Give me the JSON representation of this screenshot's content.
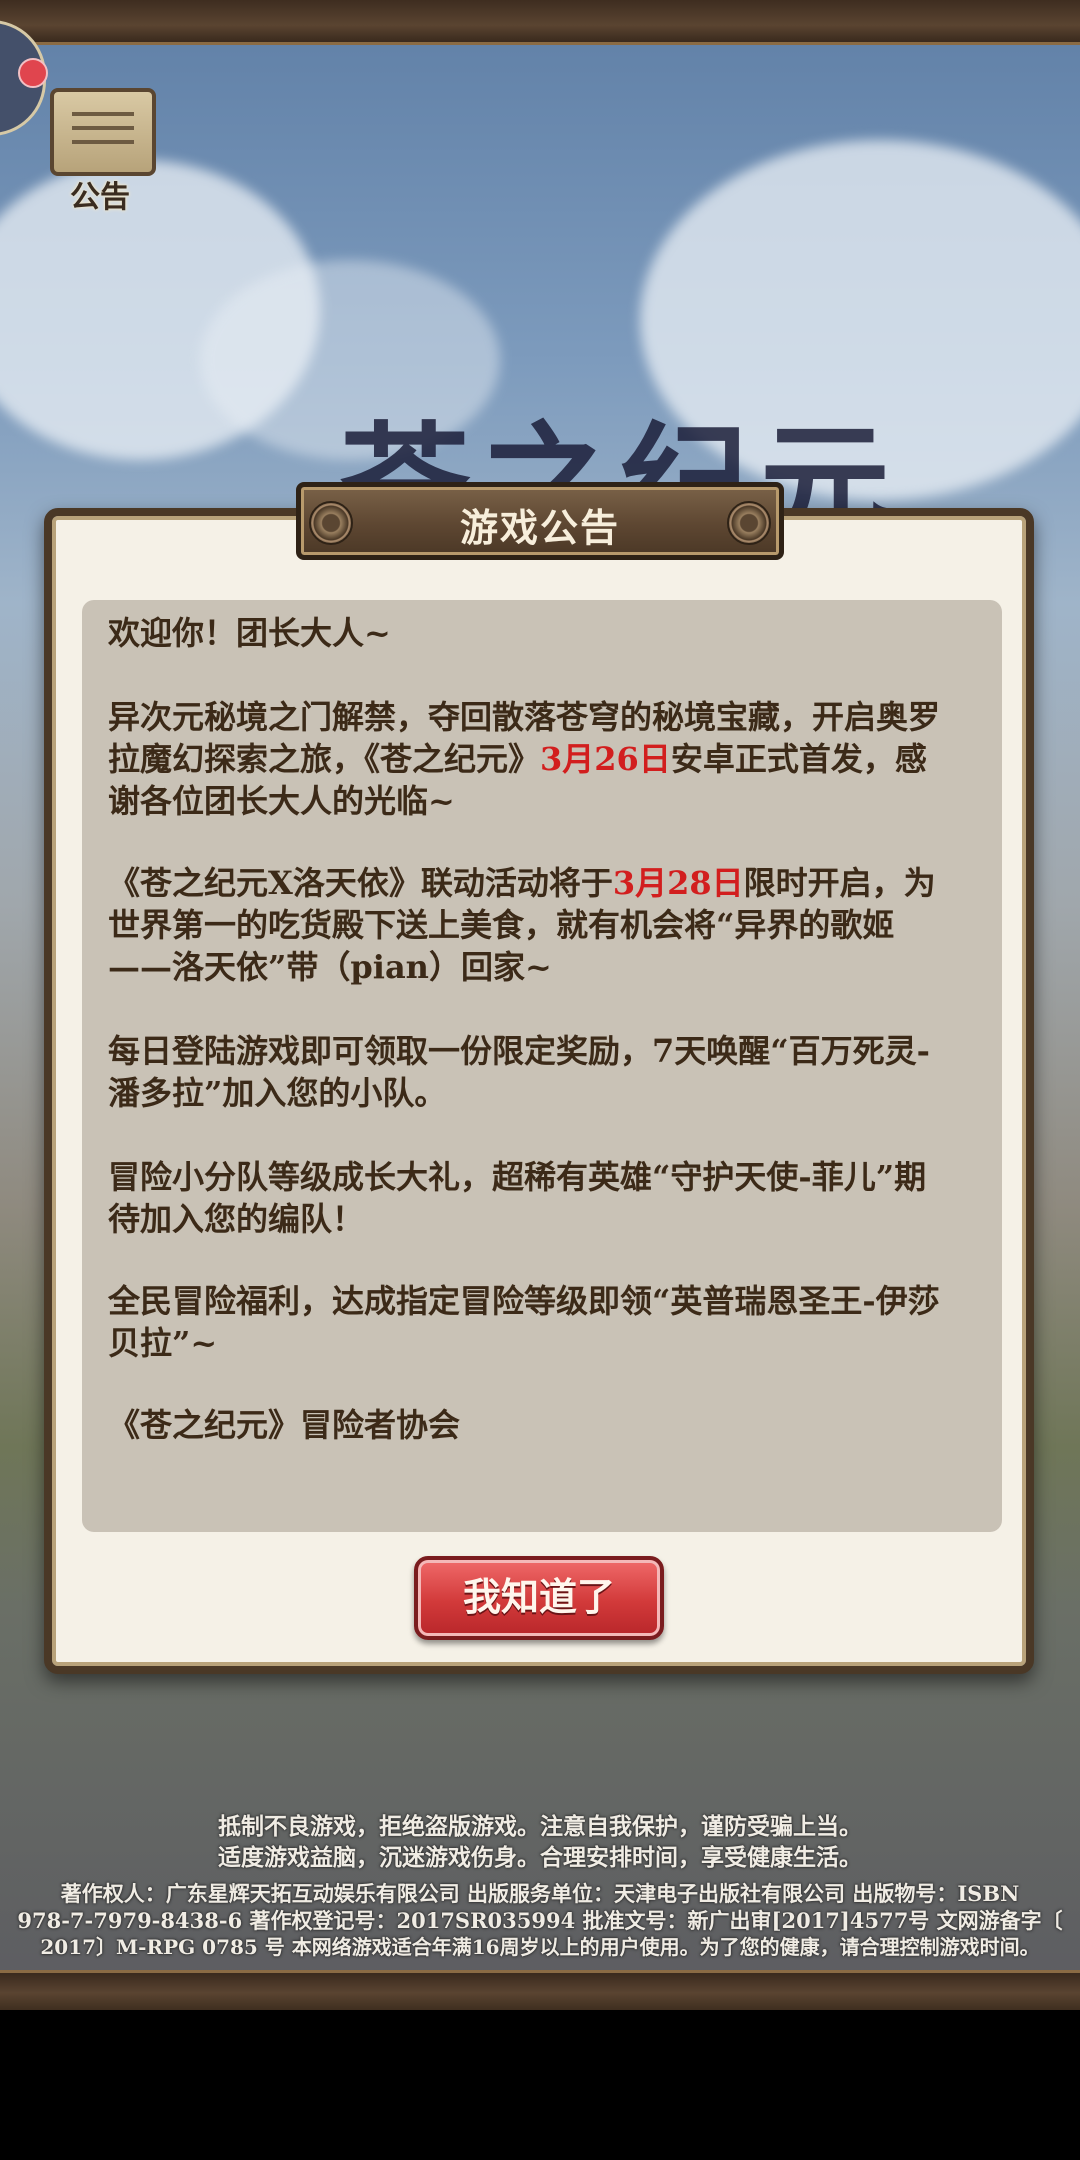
{
  "hud": {
    "notice_label": "公告"
  },
  "background": {
    "title_fragment": "苍之纪元"
  },
  "dialog": {
    "title": "游戏公告",
    "p1": "欢迎你！团长大人~",
    "p2_a": "异次元秘境之门解禁，夺回散落苍穹的秘境宝藏，开启奥罗拉魔幻探索之旅，《苍之纪元》",
    "p2_hl": "3月26日",
    "p2_b": "安卓正式首发，感谢各位团长大人的光临~",
    "p3_a": "《苍之纪元X洛天依》联动活动将于",
    "p3_hl": "3月28日",
    "p3_b": "限时开启，为世界第一的吃货殿下送上美食，就有机会将“异界的歌姬——洛天依”带（pian）回家~",
    "p4": "每日登陆游戏即可领取一份限定奖励，7天唤醒“百万死灵-潘多拉”加入您的小队。",
    "p5": "冒险小分队等级成长大礼，超稀有英雄“守护天使-菲儿”期待加入您的编队！",
    "p6": "全民冒险福利，达成指定冒险等级即领“英普瑞恩圣王-伊莎贝拉”~",
    "p7": "《苍之纪元》冒险者协会",
    "ok_button": "我知道了",
    "highlight_color": "#d21e1e"
  },
  "footer": {
    "line1": "抵制不良游戏，拒绝盗版游戏。注意自我保护，谨防受骗上当。",
    "line2": "适度游戏益脑，沉迷游戏伤身。合理安排时间，享受健康生活。",
    "line3": "著作权人：广东星辉天拓互动娱乐有限公司  出版服务单位：天津电子出版社有限公司  出版物号：ISBN",
    "line4": "978-7-7979-8438-6  著作权登记号：2017SR035994  批准文号：新广出审[2017]4577号  文网游备字〔",
    "line5": "2017〕M-RPG 0785 号   本网络游戏适合年满16周岁以上的用户使用。为了您的健康，请合理控制游戏时间。"
  }
}
